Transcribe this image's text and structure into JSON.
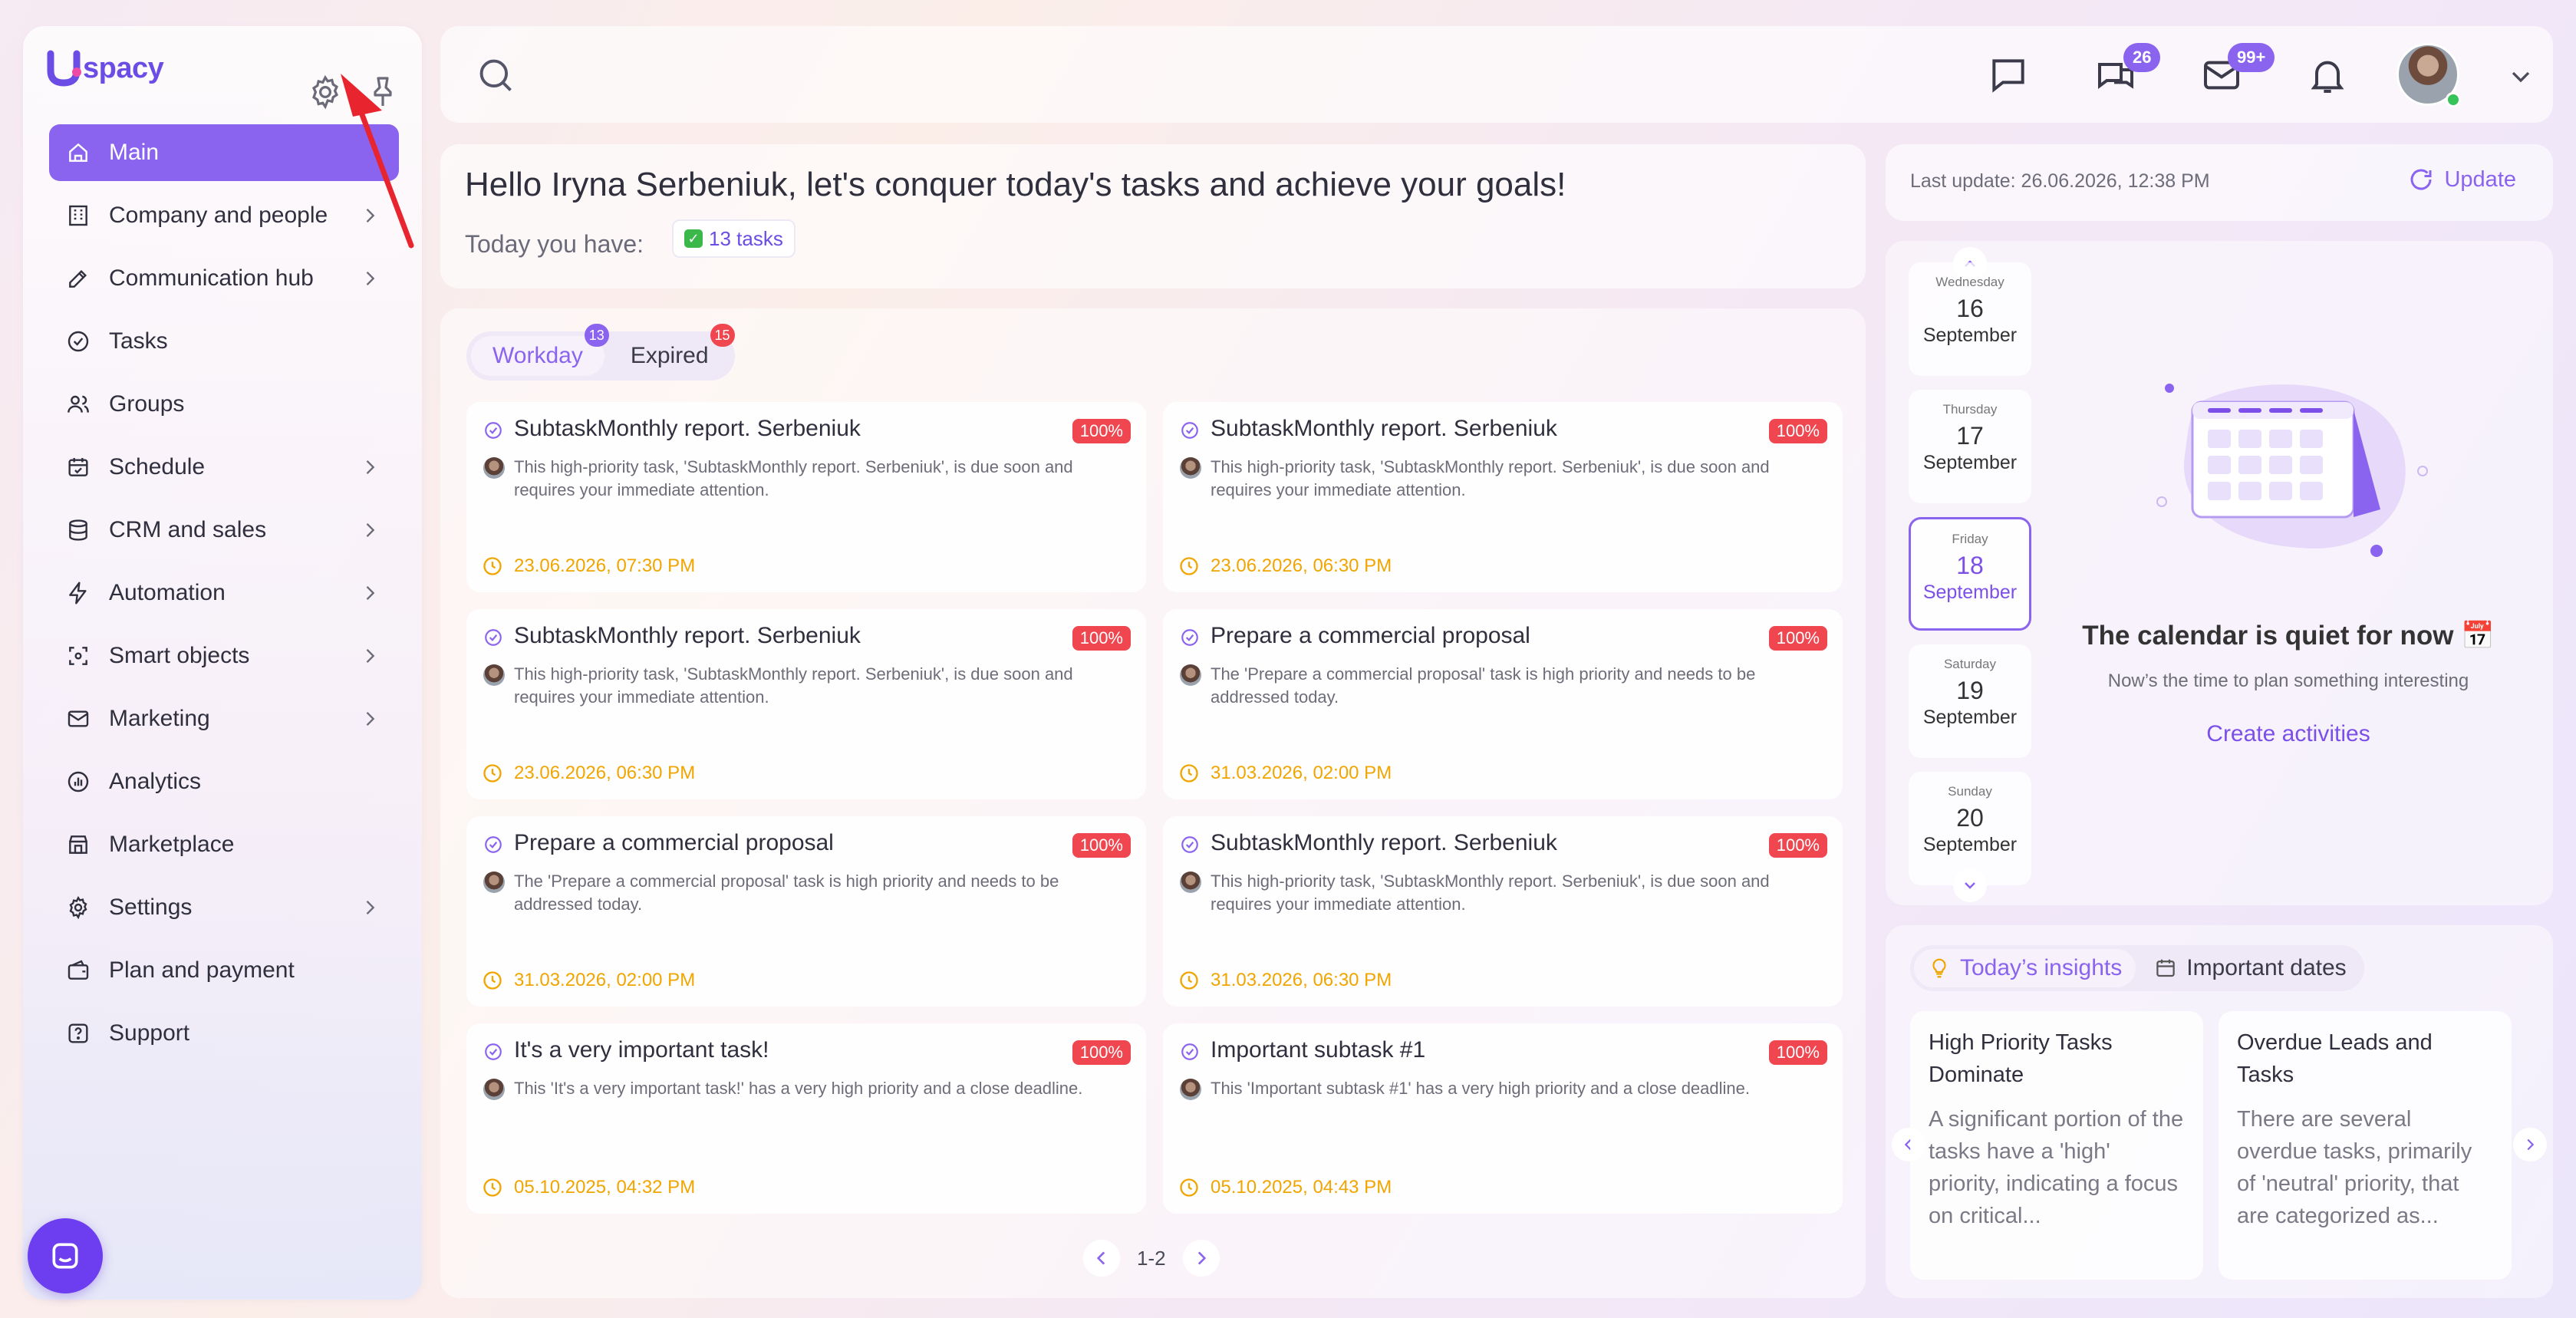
{
  "brand": {
    "name": "spacy",
    "accent": "#8a63ee",
    "danger": "#f0464f",
    "warning": "#f0a500"
  },
  "sidebar": {
    "items": [
      {
        "label": "Main",
        "icon": "home-icon",
        "active": true,
        "chevron": false
      },
      {
        "label": "Company and people",
        "icon": "building-icon",
        "chevron": true
      },
      {
        "label": "Communication hub",
        "icon": "edit-icon",
        "chevron": true
      },
      {
        "label": "Tasks",
        "icon": "check-circle-icon",
        "chevron": false
      },
      {
        "label": "Groups",
        "icon": "users-icon",
        "chevron": false
      },
      {
        "label": "Schedule",
        "icon": "calendar-icon",
        "chevron": true
      },
      {
        "label": "CRM and sales",
        "icon": "database-icon",
        "chevron": true
      },
      {
        "label": "Automation",
        "icon": "lightning-icon",
        "chevron": true
      },
      {
        "label": "Smart objects",
        "icon": "scan-icon",
        "chevron": true
      },
      {
        "label": "Marketing",
        "icon": "mail-icon",
        "chevron": true
      },
      {
        "label": "Analytics",
        "icon": "chart-icon",
        "chevron": false
      },
      {
        "label": "Marketplace",
        "icon": "store-icon",
        "chevron": false
      },
      {
        "label": "Settings",
        "icon": "gear-icon",
        "chevron": true
      },
      {
        "label": "Plan and payment",
        "icon": "wallet-icon",
        "chevron": false
      },
      {
        "label": "Support",
        "icon": "help-icon",
        "chevron": false
      }
    ]
  },
  "topbar": {
    "chat_badge": "26",
    "mail_badge": "99+"
  },
  "greeting": {
    "title": "Hello Iryna Serbeniuk, let's conquer today's tasks and achieve your goals!",
    "today_label": "Today you have:",
    "tasks_chip": "13 tasks"
  },
  "tasks": {
    "tabs": [
      {
        "label": "Workday",
        "count": "13",
        "active": true,
        "badge_color": "#8a63ee"
      },
      {
        "label": "Expired",
        "count": "15",
        "active": false,
        "badge_color": "#f0464f"
      }
    ],
    "cards": [
      {
        "title": "SubtaskMonthly report. Serbeniuk",
        "progress": "100%",
        "description": "This high-priority task, 'SubtaskMonthly report. Serbeniuk', is due soon and requires your immediate attention.",
        "due": "23.06.2026, 07:30 PM"
      },
      {
        "title": "SubtaskMonthly report. Serbeniuk",
        "progress": "100%",
        "description": "This high-priority task, 'SubtaskMonthly report. Serbeniuk', is due soon and requires your immediate attention.",
        "due": "23.06.2026, 06:30 PM"
      },
      {
        "title": "SubtaskMonthly report. Serbeniuk",
        "progress": "100%",
        "description": "This high-priority task, 'SubtaskMonthly report. Serbeniuk', is due soon and requires your immediate attention.",
        "due": "23.06.2026, 06:30 PM"
      },
      {
        "title": "Prepare a commercial proposal",
        "progress": "100%",
        "description": "The 'Prepare a commercial proposal' task is high priority and needs to be addressed today.",
        "due": "31.03.2026, 02:00 PM"
      },
      {
        "title": "Prepare a commercial proposal",
        "progress": "100%",
        "description": "The 'Prepare a commercial proposal' task is high priority and needs to be addressed today.",
        "due": "31.03.2026, 02:00 PM"
      },
      {
        "title": "SubtaskMonthly report. Serbeniuk",
        "progress": "100%",
        "description": "This high-priority task, 'SubtaskMonthly report. Serbeniuk', is due soon and requires your immediate attention.",
        "due": "31.03.2026, 06:30 PM"
      },
      {
        "title": "It's a very important task!",
        "progress": "100%",
        "description": "This 'It's a very important task!' has a very high priority and a close deadline.",
        "due": "05.10.2025, 04:32 PM"
      },
      {
        "title": "Important subtask #1",
        "progress": "100%",
        "description": "This 'Important subtask #1' has a very high priority and a close deadline.",
        "due": "05.10.2025, 04:43 PM"
      }
    ],
    "pager": "1-2"
  },
  "update": {
    "last_update": "Last update: 26.06.2026, 12:38 PM",
    "button": "Update"
  },
  "calendar": {
    "days": [
      {
        "weekday": "Wednesday",
        "day": "16",
        "month": "September",
        "selected": false
      },
      {
        "weekday": "Thursday",
        "day": "17",
        "month": "September",
        "selected": false
      },
      {
        "weekday": "Friday",
        "day": "18",
        "month": "September",
        "selected": true
      },
      {
        "weekday": "Saturday",
        "day": "19",
        "month": "September",
        "selected": false
      },
      {
        "weekday": "Sunday",
        "day": "20",
        "month": "September",
        "selected": false
      }
    ],
    "empty_title": "The calendar is quiet for now 📅",
    "empty_sub": "Now’s the time to plan something interesting",
    "create": "Create activities"
  },
  "insights": {
    "tabs": [
      {
        "label": "Today’s insights",
        "icon": "lightbulb-icon",
        "active": true
      },
      {
        "label": "Important dates",
        "icon": "calendar-icon",
        "active": false
      }
    ],
    "items": [
      {
        "title": "High Priority Tasks Dominate",
        "text": "A significant portion of the tasks have a 'high' priority, indicating a focus on critical..."
      },
      {
        "title": "Overdue Leads and Tasks",
        "text": "There are several overdue tasks, primarily of 'neutral' priority, that are categorized as..."
      }
    ]
  }
}
